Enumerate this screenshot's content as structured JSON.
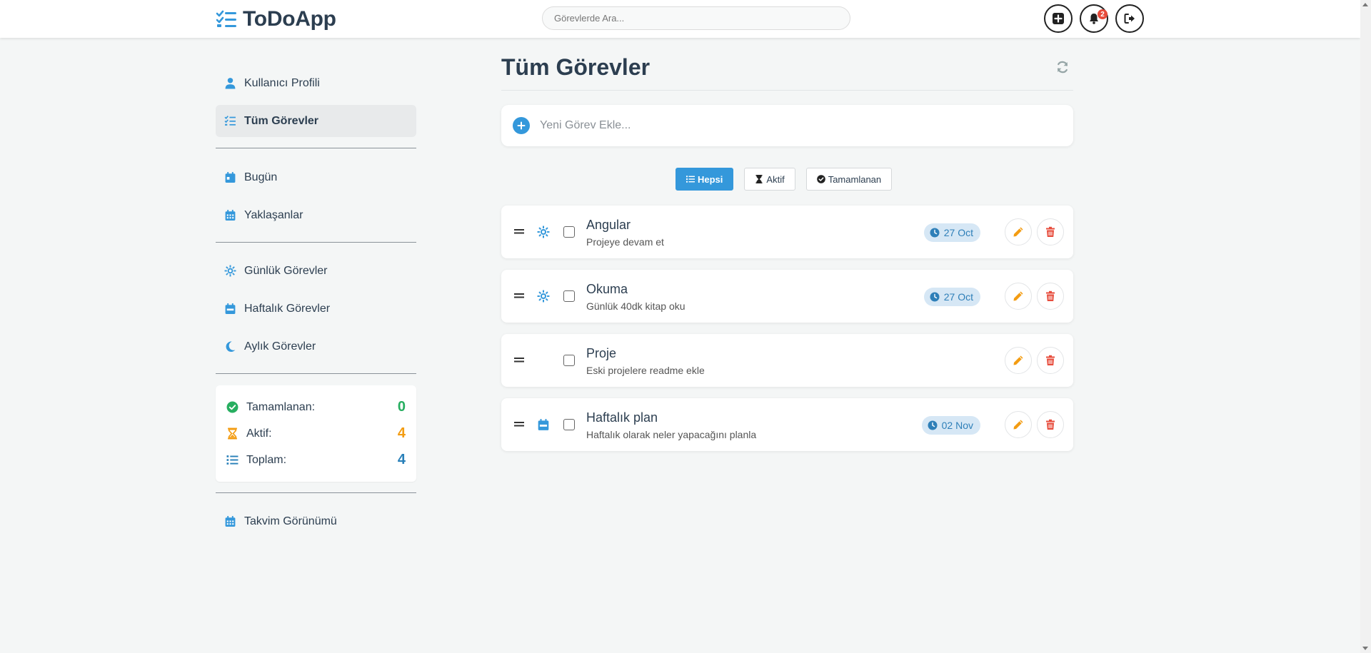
{
  "app": {
    "name": "ToDoApp"
  },
  "header": {
    "search_placeholder": "Görevlerde Ara...",
    "notification_count": "2",
    "add_icon": "plus-square-icon",
    "bell_icon": "bell-icon",
    "logout_icon": "sign-out-icon"
  },
  "sidebar": {
    "nav_top": [
      {
        "label": "Kullanıcı Profili",
        "icon": "user-icon",
        "active": false
      },
      {
        "label": "Tüm Görevler",
        "icon": "list-check-icon",
        "active": true
      }
    ],
    "nav_dates": [
      {
        "label": "Bugün",
        "icon": "calendar-day-icon"
      },
      {
        "label": "Yaklaşanlar",
        "icon": "calendar-icon"
      }
    ],
    "nav_recurring": [
      {
        "label": "Günlük Görevler",
        "icon": "sun-icon"
      },
      {
        "label": "Haftalık Görevler",
        "icon": "calendar-week-icon"
      },
      {
        "label": "Aylık Görevler",
        "icon": "moon-icon"
      }
    ],
    "stats": [
      {
        "label": "Tamamlanan:",
        "value": "0",
        "color": "#27ae60",
        "icon": "check-circle-icon"
      },
      {
        "label": "Aktif:",
        "value": "4",
        "color": "#f39c12",
        "icon": "hourglass-icon"
      },
      {
        "label": "Toplam:",
        "value": "4",
        "color": "#2980b9",
        "icon": "list-icon"
      }
    ],
    "calendar_view": {
      "label": "Takvim Görünümü",
      "icon": "calendar-icon"
    }
  },
  "main": {
    "title": "Tüm Görevler",
    "add_placeholder": "Yeni Görev Ekle...",
    "filters": [
      {
        "label": "Hepsi",
        "icon": "list-icon",
        "active": true
      },
      {
        "label": "Aktif",
        "icon": "hourglass-icon",
        "active": false
      },
      {
        "label": "Tamamlanan",
        "icon": "check-circle-icon",
        "active": false
      }
    ],
    "tasks": [
      {
        "title": "Angular",
        "description": "Projeye devam et",
        "date": "27 Oct",
        "type_icon": "sun-icon"
      },
      {
        "title": "Okuma",
        "description": "Günlük 40dk kitap oku",
        "date": "27 Oct",
        "type_icon": "sun-icon"
      },
      {
        "title": "Proje",
        "description": "Eski projelere readme ekle",
        "date": "",
        "type_icon": ""
      },
      {
        "title": "Haftalık plan",
        "description": "Haftalık olarak neler yapacağını planla",
        "date": "02 Nov",
        "type_icon": "calendar-week-icon"
      }
    ]
  },
  "colors": {
    "accent": "#3498db",
    "edit": "#f39c12",
    "delete": "#e74c3c",
    "text": "#2c3e50"
  }
}
